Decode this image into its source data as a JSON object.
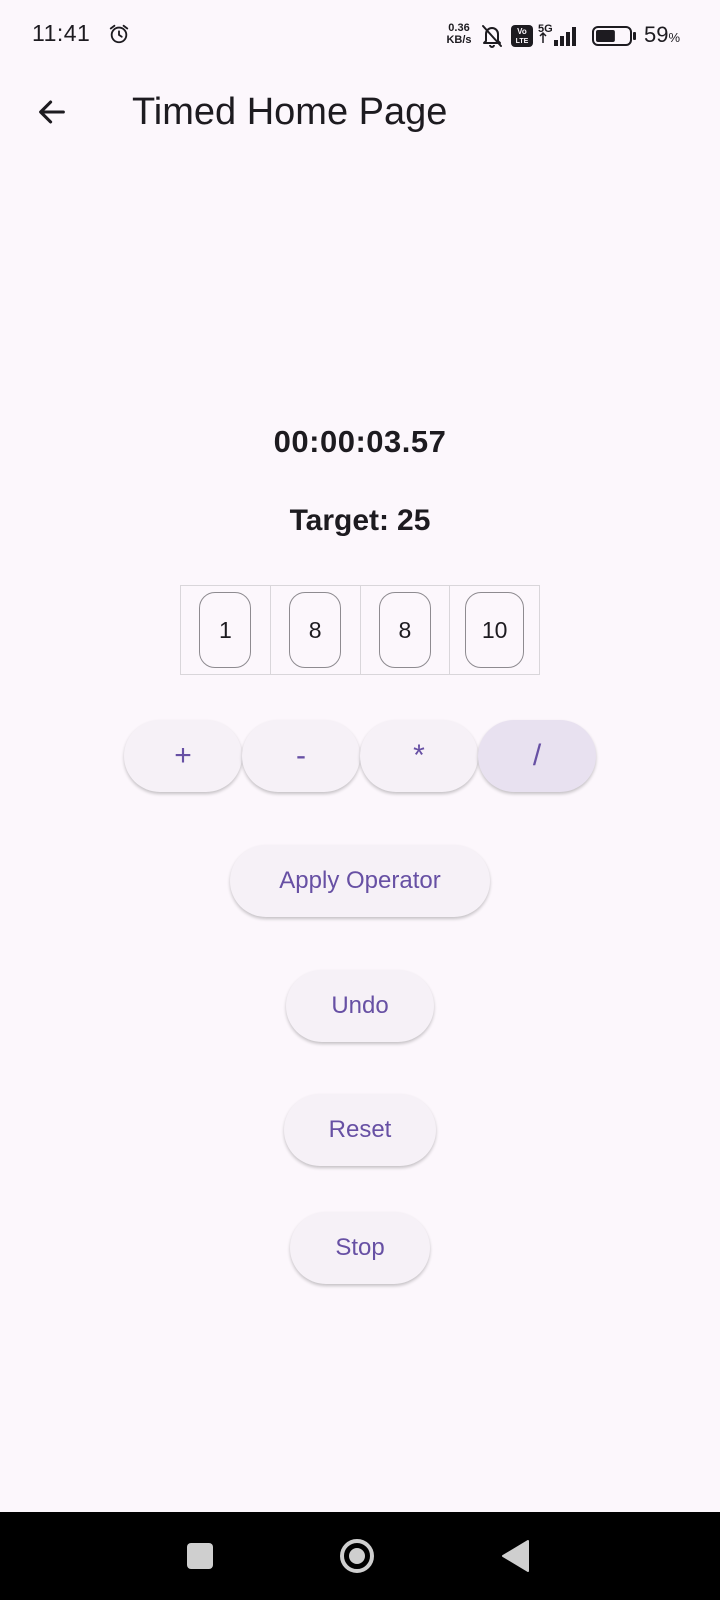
{
  "status_bar": {
    "time": "11:41",
    "net_speed_value": "0.36",
    "net_speed_unit": "KB/s",
    "network_label": "5G",
    "volte_label": "Vo LTE",
    "battery_percent": "59",
    "battery_unit": "%",
    "battery_level": 0.59,
    "icons": [
      "alarm-icon",
      "mute-icon",
      "volte-icon",
      "signal-icon",
      "battery-icon"
    ]
  },
  "app_bar": {
    "back_icon": "arrow-left-icon",
    "title": "Timed Home Page"
  },
  "game": {
    "timer": "00:00:03.57",
    "target_label": "Target:",
    "target_value": "25",
    "numbers": [
      "1",
      "8",
      "8",
      "10"
    ],
    "operators": [
      "+",
      "-",
      "*",
      "/"
    ],
    "selected_operator": "/"
  },
  "actions": {
    "apply_label": "Apply Operator",
    "undo_label": "Undo",
    "reset_label": "Reset",
    "stop_label": "Stop"
  },
  "nav_bar": {
    "icons": [
      "recents-square-icon",
      "home-circle-icon",
      "back-triangle-icon"
    ]
  },
  "colors": {
    "background": "#fcf7fc",
    "accent": "#6750a4",
    "button_surface": "#f6f1f7",
    "selected_surface": "#e8e1f0",
    "text": "#1d1b20"
  }
}
